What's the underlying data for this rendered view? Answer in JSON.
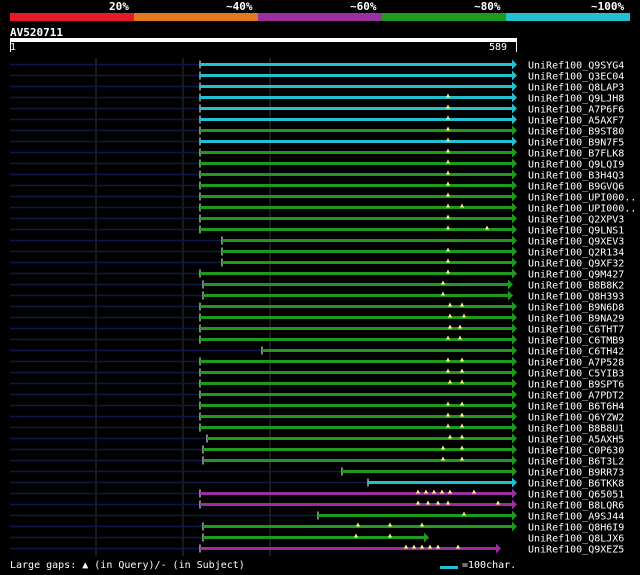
{
  "legend": [
    {
      "label": "20%",
      "color": "#e8182c"
    },
    {
      "label": "~40%",
      "color": "#e07a20"
    },
    {
      "label": "~60%",
      "color": "#9a2fa0"
    },
    {
      "label": "~80%",
      "color": "#1e9a1e"
    },
    {
      "label": "~100%",
      "color": "#22c0d0"
    }
  ],
  "query": {
    "name": "AV520711",
    "start": "1",
    "end": "589"
  },
  "footer": {
    "text": "Large gaps: ▲ (in Query)/- (in Subject)",
    "scale": "=100char."
  },
  "hits": [
    {
      "name": "UniRef100_Q9SYG4",
      "color": "#22c0d0",
      "start": 200,
      "end": 512,
      "marks": []
    },
    {
      "name": "UniRef100_Q3EC04",
      "color": "#22c0d0",
      "start": 200,
      "end": 512,
      "marks": []
    },
    {
      "name": "UniRef100_Q8LAP3",
      "color": "#22c0d0",
      "start": 200,
      "end": 512,
      "marks": []
    },
    {
      "name": "UniRef100_Q9LJH8",
      "color": "#22c0d0",
      "start": 200,
      "end": 512,
      "marks": [
        448
      ]
    },
    {
      "name": "UniRef100_A7P6F6",
      "color": "#22c0d0",
      "start": 200,
      "end": 512,
      "marks": [
        448
      ]
    },
    {
      "name": "UniRef100_A5AXF7",
      "color": "#22c0d0",
      "start": 200,
      "end": 512,
      "marks": [
        448
      ]
    },
    {
      "name": "UniRef100_B9ST80",
      "color": "#1e9a1e",
      "start": 200,
      "end": 512,
      "marks": [
        448
      ]
    },
    {
      "name": "UniRef100_B9N7F5",
      "color": "#22c0d0",
      "start": 200,
      "end": 512,
      "marks": [
        448
      ]
    },
    {
      "name": "UniRef100_B7FLK8",
      "color": "#1e9a1e",
      "start": 200,
      "end": 512,
      "marks": [
        448
      ]
    },
    {
      "name": "UniRef100_Q9LQI9",
      "color": "#1e9a1e",
      "start": 200,
      "end": 512,
      "marks": [
        448
      ]
    },
    {
      "name": "UniRef100_B3H4Q3",
      "color": "#1e9a1e",
      "start": 200,
      "end": 512,
      "marks": [
        448
      ]
    },
    {
      "name": "UniRef100_B9GVQ6",
      "color": "#1e9a1e",
      "start": 200,
      "end": 512,
      "marks": [
        448
      ]
    },
    {
      "name": "UniRef100_UPI000..",
      "color": "#1e9a1e",
      "start": 200,
      "end": 512,
      "marks": [
        448
      ]
    },
    {
      "name": "UniRef100_UPI000..",
      "color": "#1e9a1e",
      "start": 200,
      "end": 512,
      "marks": [
        448,
        462
      ]
    },
    {
      "name": "UniRef100_Q2XPV3",
      "color": "#1e9a1e",
      "start": 200,
      "end": 512,
      "marks": [
        448
      ]
    },
    {
      "name": "UniRef100_Q9LNS1",
      "color": "#1e9a1e",
      "start": 200,
      "end": 512,
      "marks": [
        448,
        487
      ]
    },
    {
      "name": "UniRef100_Q9XEV3",
      "color": "#1e9a1e",
      "start": 222,
      "end": 512,
      "marks": []
    },
    {
      "name": "UniRef100_Q2R134",
      "color": "#1e9a1e",
      "start": 222,
      "end": 512,
      "marks": [
        448
      ]
    },
    {
      "name": "UniRef100_Q9XF32",
      "color": "#1e9a1e",
      "start": 222,
      "end": 512,
      "marks": [
        448
      ]
    },
    {
      "name": "UniRef100_Q9M427",
      "color": "#1e9a1e",
      "start": 200,
      "end": 512,
      "marks": [
        448
      ]
    },
    {
      "name": "UniRef100_B8B8K2",
      "color": "#1e9a1e",
      "start": 203,
      "end": 508,
      "marks": [
        443
      ]
    },
    {
      "name": "UniRef100_Q8H393",
      "color": "#1e9a1e",
      "start": 203,
      "end": 508,
      "marks": [
        443
      ]
    },
    {
      "name": "UniRef100_B9N6D8",
      "color": "#1e9a1e",
      "start": 200,
      "end": 512,
      "marks": [
        450,
        462
      ]
    },
    {
      "name": "UniRef100_B9NA29",
      "color": "#1e9a1e",
      "start": 200,
      "end": 512,
      "marks": [
        450,
        464
      ]
    },
    {
      "name": "UniRef100_C6THT7",
      "color": "#1e9a1e",
      "start": 200,
      "end": 512,
      "marks": [
        450,
        460
      ]
    },
    {
      "name": "UniRef100_C6TMB9",
      "color": "#1e9a1e",
      "start": 200,
      "end": 512,
      "marks": [
        448,
        460
      ]
    },
    {
      "name": "UniRef100_C6TH42",
      "color": "#1e9a1e",
      "start": 262,
      "end": 512,
      "marks": []
    },
    {
      "name": "UniRef100_A7P528",
      "color": "#1e9a1e",
      "start": 200,
      "end": 512,
      "marks": [
        448,
        462
      ]
    },
    {
      "name": "UniRef100_C5YIB3",
      "color": "#1e9a1e",
      "start": 200,
      "end": 512,
      "marks": [
        448,
        462
      ]
    },
    {
      "name": "UniRef100_B9SPT6",
      "color": "#1e9a1e",
      "start": 200,
      "end": 512,
      "marks": [
        450,
        462
      ]
    },
    {
      "name": "UniRef100_A7PDT2",
      "color": "#1e9a1e",
      "start": 200,
      "end": 512,
      "marks": []
    },
    {
      "name": "UniRef100_B6T6H4",
      "color": "#1e9a1e",
      "start": 200,
      "end": 512,
      "marks": [
        448,
        462
      ]
    },
    {
      "name": "UniRef100_Q6YZW2",
      "color": "#1e9a1e",
      "start": 200,
      "end": 512,
      "marks": [
        448,
        462
      ]
    },
    {
      "name": "UniRef100_B8B8U1",
      "color": "#1e9a1e",
      "start": 200,
      "end": 512,
      "marks": [
        448,
        462
      ]
    },
    {
      "name": "UniRef100_A5AXH5",
      "color": "#1e9a1e",
      "start": 207,
      "end": 512,
      "marks": [
        450,
        462
      ]
    },
    {
      "name": "UniRef100_C0P630",
      "color": "#1e9a1e",
      "start": 203,
      "end": 512,
      "marks": [
        443,
        462
      ]
    },
    {
      "name": "UniRef100_B6T3L2",
      "color": "#1e9a1e",
      "start": 203,
      "end": 512,
      "marks": [
        443,
        462
      ]
    },
    {
      "name": "UniRef100_B9RR73",
      "color": "#1e9a1e",
      "start": 342,
      "end": 512,
      "marks": []
    },
    {
      "name": "UniRef100_B6TKK8",
      "color": "#22c0d0",
      "start": 368,
      "end": 512,
      "marks": []
    },
    {
      "name": "UniRef100_Q65051",
      "color": "#9a2fa0",
      "start": 200,
      "end": 512,
      "marks": [
        418,
        426,
        434,
        442,
        450,
        474
      ]
    },
    {
      "name": "UniRef100_B8LQR6",
      "color": "#9a2fa0",
      "start": 200,
      "end": 512,
      "marks": [
        418,
        428,
        438,
        448,
        498
      ]
    },
    {
      "name": "UniRef100_A9SJ44",
      "color": "#1e9a1e",
      "start": 318,
      "end": 512,
      "marks": [
        464
      ]
    },
    {
      "name": "UniRef100_Q8H6I9",
      "color": "#1e9a1e",
      "start": 203,
      "end": 512,
      "marks": [
        358,
        390,
        422
      ]
    },
    {
      "name": "UniRef100_Q8LJX6",
      "color": "#1e9a1e",
      "start": 203,
      "end": 424,
      "marks": [
        356,
        390
      ]
    },
    {
      "name": "UniRef100_Q9XEZ5",
      "color": "#9a2fa0",
      "start": 200,
      "end": 496,
      "marks": [
        406,
        414,
        422,
        430,
        438,
        458
      ]
    }
  ]
}
